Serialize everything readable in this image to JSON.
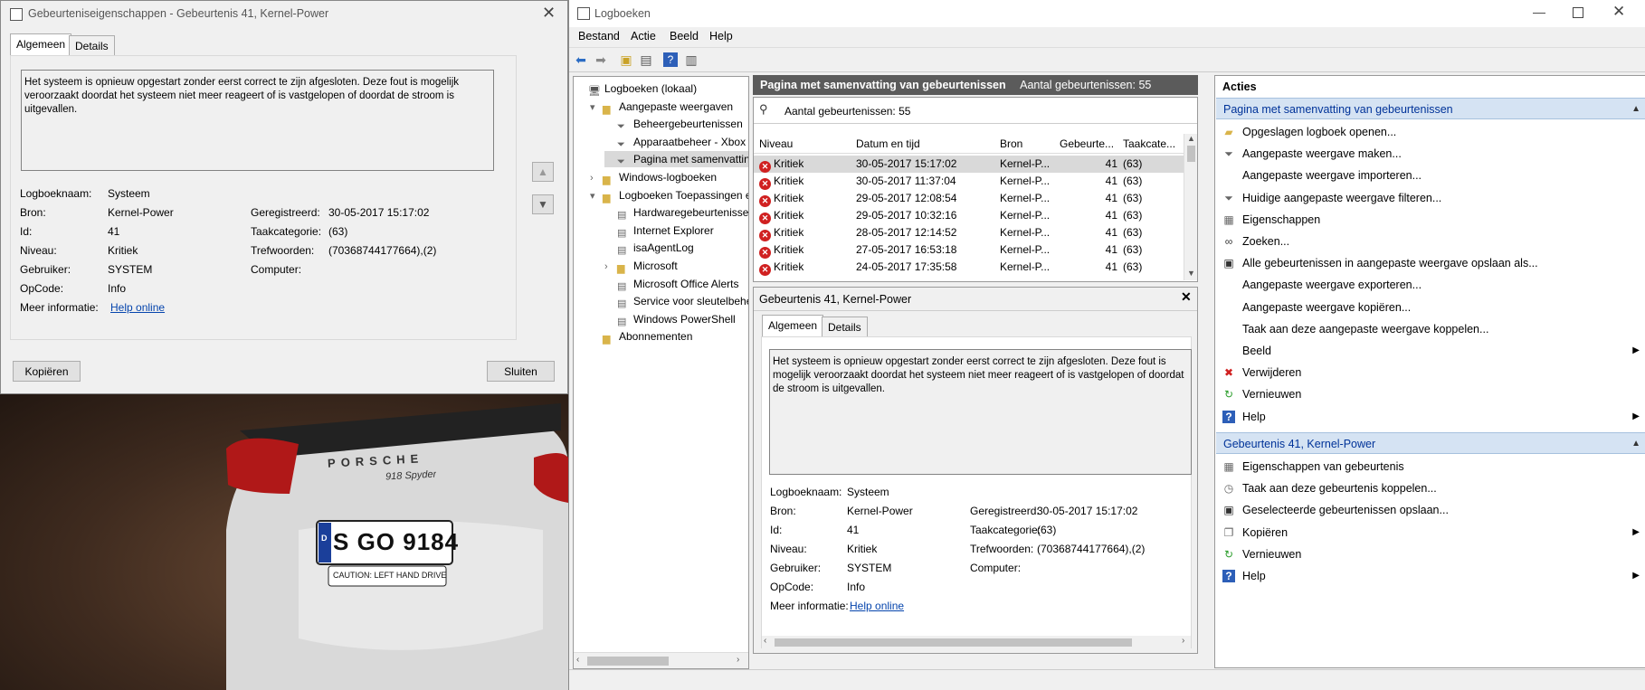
{
  "dialog": {
    "title": "Gebeurteniseigenschappen - Gebeurtenis 41, Kernel-Power",
    "tabs": [
      "Algemeen",
      "Details"
    ],
    "description": "Het systeem is opnieuw opgestart zonder eerst correct te zijn afgesloten. Deze fout is mogelijk veroorzaakt doordat het systeem niet meer reageert of is vastgelopen of doordat de stroom is uitgevallen.",
    "fields": {
      "logboeknaam_label": "Logboeknaam:",
      "logboeknaam": "Systeem",
      "bron_label": "Bron:",
      "bron": "Kernel-Power",
      "geregistreerd_label": "Geregistreerd:",
      "geregistreerd": "30-05-2017 15:17:02",
      "id_label": "Id:",
      "id": "41",
      "taakcategorie_label": "Taakcategorie:",
      "taakcategorie": "(63)",
      "niveau_label": "Niveau:",
      "niveau": "Kritiek",
      "trefwoorden_label": "Trefwoorden:",
      "trefwoorden": "(70368744177664),(2)",
      "gebruiker_label": "Gebruiker:",
      "gebruiker": "SYSTEM",
      "computer_label": "Computer:",
      "computer": "",
      "opcode_label": "OpCode:",
      "opcode": "Info",
      "meer_label": "Meer informatie:",
      "meer_link": "Help online"
    },
    "copy_button": "Kopiëren",
    "close_button": "Sluiten",
    "car_plate": "S GO 9184",
    "car_plate_country": "D",
    "car_brand": "PORSCHE",
    "car_model": "918 Spyder",
    "car_sign": "CAUTION: LEFT HAND DRIVE"
  },
  "main": {
    "title": "Logboeken",
    "menu": [
      "Bestand",
      "Actie",
      "Beeld",
      "Help"
    ],
    "tree": [
      {
        "label": "Logboeken (lokaal)",
        "indent": 0,
        "expander": "",
        "icon": "computer-icon"
      },
      {
        "label": "Aangepaste weergaven",
        "indent": 1,
        "expander": "▾",
        "icon": "folder-icon"
      },
      {
        "label": "Beheergebeurtenissen",
        "indent": 2,
        "expander": "",
        "icon": "filter-icon"
      },
      {
        "label": "Apparaatbeheer - Xbox W",
        "indent": 2,
        "expander": "",
        "icon": "filter-icon"
      },
      {
        "label": "Pagina met samenvatting",
        "indent": 2,
        "expander": "",
        "icon": "filter-icon",
        "selected": true
      },
      {
        "label": "Windows-logboeken",
        "indent": 1,
        "expander": "›",
        "icon": "folder-icon"
      },
      {
        "label": "Logboeken Toepassingen en",
        "indent": 1,
        "expander": "▾",
        "icon": "folder-icon"
      },
      {
        "label": "Hardwaregebeurtenissen",
        "indent": 2,
        "expander": "",
        "icon": "log-icon"
      },
      {
        "label": "Internet Explorer",
        "indent": 2,
        "expander": "",
        "icon": "log-icon"
      },
      {
        "label": "isaAgentLog",
        "indent": 2,
        "expander": "",
        "icon": "log-icon"
      },
      {
        "label": "Microsoft",
        "indent": 2,
        "expander": "›",
        "icon": "folder-icon"
      },
      {
        "label": "Microsoft Office Alerts",
        "indent": 2,
        "expander": "",
        "icon": "log-icon"
      },
      {
        "label": "Service voor sleutelbehee",
        "indent": 2,
        "expander": "",
        "icon": "log-icon"
      },
      {
        "label": "Windows PowerShell",
        "indent": 2,
        "expander": "",
        "icon": "log-icon"
      },
      {
        "label": "Abonnementen",
        "indent": 1,
        "expander": "",
        "icon": "subscription-icon"
      }
    ],
    "events_header": "Pagina met samenvatting van gebeurtenissen",
    "events_count_header": "Aantal gebeurtenissen: 55",
    "filter_line": "Aantal gebeurtenissen: 55",
    "columns": [
      "Niveau",
      "Datum en tijd",
      "Bron",
      "Gebeurte...",
      "Taakcate..."
    ],
    "rows": [
      [
        "Kritiek",
        "30-05-2017 15:17:02",
        "Kernel-P...",
        "41",
        "(63)"
      ],
      [
        "Kritiek",
        "30-05-2017 11:37:04",
        "Kernel-P...",
        "41",
        "(63)"
      ],
      [
        "Kritiek",
        "29-05-2017 12:08:54",
        "Kernel-P...",
        "41",
        "(63)"
      ],
      [
        "Kritiek",
        "29-05-2017 10:32:16",
        "Kernel-P...",
        "41",
        "(63)"
      ],
      [
        "Kritiek",
        "28-05-2017 12:14:52",
        "Kernel-P...",
        "41",
        "(63)"
      ],
      [
        "Kritiek",
        "27-05-2017 16:53:18",
        "Kernel-P...",
        "41",
        "(63)"
      ],
      [
        "Kritiek",
        "24-05-2017 17:35:58",
        "Kernel-P...",
        "41",
        "(63)"
      ]
    ],
    "detail": {
      "title": "Gebeurtenis 41, Kernel-Power",
      "tabs": [
        "Algemeen",
        "Details"
      ],
      "description": "Het systeem is opnieuw opgestart zonder eerst correct te zijn afgesloten. Deze fout is mogelijk veroorzaakt doordat het systeem niet meer reageert of is vastgelopen of doordat de stroom is uitgevallen.",
      "fields": {
        "logboeknaam_label": "Logboeknaam:",
        "logboeknaam": "Systeem",
        "bron_label": "Bron:",
        "bron": "Kernel-Power",
        "geregistreerd_label": "Geregistreerd:",
        "geregistreerd": "30-05-2017 15:17:02",
        "id_label": "Id:",
        "id": "41",
        "taakcategorie_label": "Taakcategorie:",
        "taakcategorie": "(63)",
        "niveau_label": "Niveau:",
        "niveau": "Kritiek",
        "trefwoorden_label": "Trefwoorden:",
        "trefwoorden": "(70368744177664),(2)",
        "gebruiker_label": "Gebruiker:",
        "gebruiker": "SYSTEM",
        "computer_label": "Computer:",
        "computer": "",
        "opcode_label": "OpCode:",
        "opcode": "Info",
        "meer_label": "Meer informatie:",
        "meer_link": "Help online"
      }
    },
    "actions": {
      "title": "Acties",
      "section1": {
        "title": "Pagina met samenvatting van gebeurtenissen",
        "items": [
          {
            "label": "Opgeslagen logboek openen...",
            "icon": "open-folder-icon",
            "arrow": false
          },
          {
            "label": "Aangepaste weergave maken...",
            "icon": "filter-icon",
            "arrow": false
          },
          {
            "label": "Aangepaste weergave importeren...",
            "icon": "",
            "arrow": false
          },
          {
            "label": "Huidige aangepaste weergave filteren...",
            "icon": "filter-icon",
            "arrow": false
          },
          {
            "label": "Eigenschappen",
            "icon": "properties-icon",
            "arrow": false
          },
          {
            "label": "Zoeken...",
            "icon": "binoculars-icon",
            "arrow": false
          },
          {
            "label": "Alle gebeurtenissen in aangepaste weergave opslaan als...",
            "icon": "save-icon",
            "arrow": false
          },
          {
            "label": "Aangepaste weergave exporteren...",
            "icon": "",
            "arrow": false
          },
          {
            "label": "Aangepaste weergave kopiëren...",
            "icon": "",
            "arrow": false
          },
          {
            "label": "Taak aan deze aangepaste weergave koppelen...",
            "icon": "",
            "arrow": false
          },
          {
            "label": "Beeld",
            "icon": "",
            "arrow": true
          },
          {
            "label": "Verwijderen",
            "icon": "delete-icon",
            "arrow": false
          },
          {
            "label": "Vernieuwen",
            "icon": "refresh-icon",
            "arrow": false
          },
          {
            "label": "Help",
            "icon": "help-icon",
            "arrow": true
          }
        ]
      },
      "section2": {
        "title": "Gebeurtenis 41, Kernel-Power",
        "items": [
          {
            "label": "Eigenschappen van gebeurtenis",
            "icon": "properties-icon",
            "arrow": false
          },
          {
            "label": "Taak aan deze gebeurtenis koppelen...",
            "icon": "task-icon",
            "arrow": false
          },
          {
            "label": "Geselecteerde gebeurtenissen opslaan...",
            "icon": "save-icon",
            "arrow": false
          },
          {
            "label": "Kopiëren",
            "icon": "copy-icon",
            "arrow": true
          },
          {
            "label": "Vernieuwen",
            "icon": "refresh-icon",
            "arrow": false
          },
          {
            "label": "Help",
            "icon": "help-icon",
            "arrow": true
          }
        ]
      }
    }
  },
  "colors": {
    "header_gray": "#5b5b5b",
    "section_blue": "#d5e3f3",
    "section_text": "#003399",
    "critical_red": "#d02020"
  }
}
